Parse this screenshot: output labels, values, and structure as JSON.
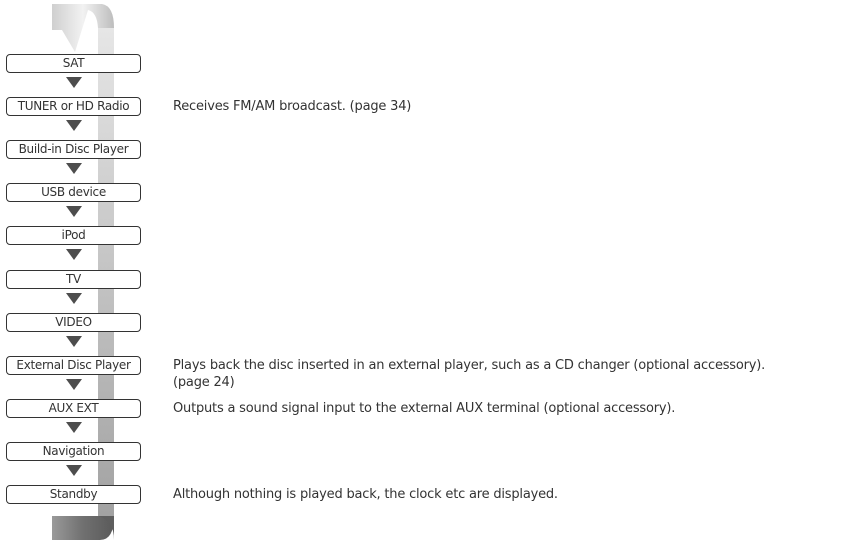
{
  "sources": [
    {
      "label": "SAT",
      "description": []
    },
    {
      "label": "TUNER or HD Radio",
      "description": [
        "Receives FM/AM broadcast. (page 34)"
      ]
    },
    {
      "label": "Build-in Disc Player",
      "description": []
    },
    {
      "label": "USB device",
      "description": []
    },
    {
      "label": "iPod",
      "description": []
    },
    {
      "label": "TV",
      "description": []
    },
    {
      "label": "VIDEO",
      "description": []
    },
    {
      "label": "External Disc Player",
      "description": [
        "Plays back the disc inserted in an external player, such as a CD changer (optional accessory).",
        "(page 24)"
      ]
    },
    {
      "label": "AUX EXT",
      "description": [
        "Outputs a sound signal input to the external AUX terminal (optional accessory)."
      ]
    },
    {
      "label": "Navigation",
      "description": []
    },
    {
      "label": "Standby",
      "description": [
        "Although nothing is played back, the clock etc are displayed."
      ]
    }
  ],
  "colors": {
    "ribbon_light": "#e2e2e2",
    "ribbon_mid": "#a6a6a6",
    "ribbon_dark": "#707070",
    "arrow": "#4d4d4d",
    "text": "#333333",
    "border": "#333333"
  },
  "icons": {
    "cycle_arrow": "down-triangle-icon"
  }
}
